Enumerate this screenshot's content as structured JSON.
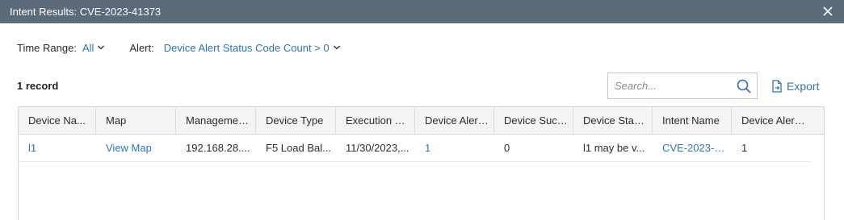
{
  "dialog": {
    "title": "Intent Results: CVE-2023-41373"
  },
  "filters": {
    "time_range_label": "Time Range:",
    "time_range_value": "All",
    "alert_label": "Alert:",
    "alert_value": "Device Alert Status Code Count > 0"
  },
  "toolbar": {
    "record_count": "1 record",
    "search_placeholder": "Search...",
    "search_value": "",
    "export_label": "Export"
  },
  "table": {
    "columns": [
      "Device Na...",
      "Map",
      "Managemen...",
      "Device Type",
      "Execution Ti...",
      "Device Alert ...",
      "Device Succ...",
      "Device Statu...",
      "Intent Name",
      "Device Alert ..."
    ],
    "rows": [
      {
        "device_name": "l1",
        "map": "View Map",
        "management_ip": "192.168.28....",
        "device_type": "F5 Load Bal...",
        "execution_time": "11/30/2023,...",
        "device_alert_count": "1",
        "device_success": "0",
        "device_status": "l1 may be v...",
        "intent_name": "CVE-2023-4...",
        "device_alert_code": "1"
      }
    ]
  },
  "colors": {
    "titlebar_bg": "#5b6b79",
    "link": "#2e74b5",
    "header_bg": "#f3f4f5"
  },
  "icons": {
    "close": "close-icon",
    "chevron": "chevron-down-icon",
    "search": "search-icon",
    "export": "export-icon"
  }
}
